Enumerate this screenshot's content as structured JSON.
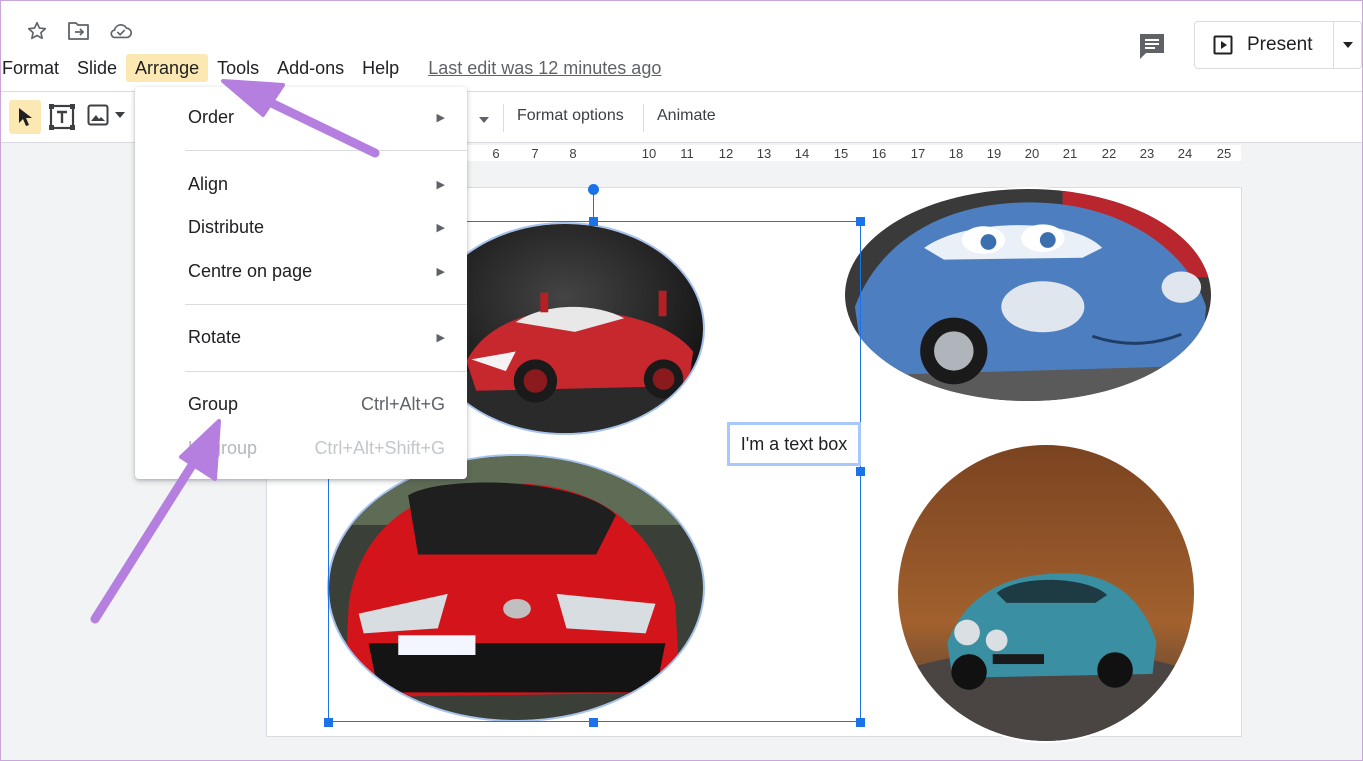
{
  "menubar": {
    "items": [
      {
        "label": "Format"
      },
      {
        "label": "Slide"
      },
      {
        "label": "Arrange"
      },
      {
        "label": "Tools"
      },
      {
        "label": "Add-ons"
      },
      {
        "label": "Help"
      }
    ],
    "last_edit": "Last edit was 12 minutes ago"
  },
  "header": {
    "present_label": "Present"
  },
  "toolbar": {
    "format_options": "Format options",
    "animate": "Animate"
  },
  "ruler": {
    "ticks": [
      "6",
      "7",
      "8",
      "10",
      "11",
      "12",
      "13",
      "14",
      "15",
      "16",
      "17",
      "18",
      "19",
      "20",
      "21",
      "22",
      "23",
      "24",
      "25"
    ]
  },
  "arrange_menu": {
    "order": "Order",
    "align": "Align",
    "distribute": "Distribute",
    "centre_on_page": "Centre on page",
    "rotate": "Rotate",
    "group": "Group",
    "group_shortcut": "Ctrl+Alt+G",
    "ungroup": "Ungroup",
    "ungroup_shortcut": "Ctrl+Alt+Shift+G"
  },
  "slide": {
    "textbox": "I'm a text box"
  },
  "colors": {
    "accent": "#1a73e8",
    "menu_highlight": "#fce8b2",
    "annotation_arrow": "#b57fe0"
  }
}
